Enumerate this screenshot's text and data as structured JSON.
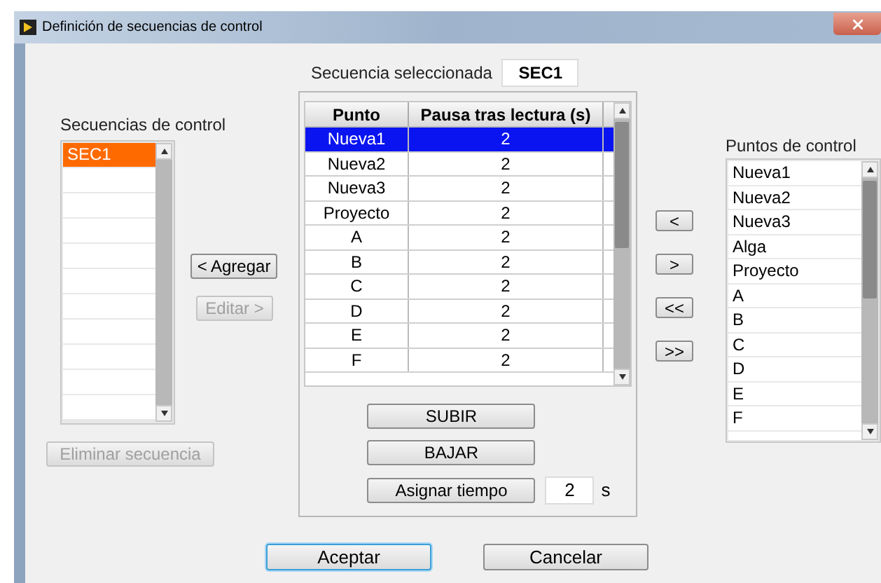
{
  "window": {
    "title": "Definición de secuencias de control"
  },
  "sequences": {
    "label": "Secuencias de control",
    "items": [
      {
        "label": "SEC1",
        "selected": true
      }
    ]
  },
  "sequence_buttons": [
    {
      "label": "< Agregar",
      "disabled": false
    },
    {
      "label": "Editar >",
      "disabled": true
    }
  ],
  "delete_button": {
    "label": "Eliminar secuencia",
    "disabled": true
  },
  "selected_sequence": {
    "label": "Secuencia seleccionada",
    "value": "SEC1"
  },
  "table": {
    "columns": [
      "Punto",
      "Pausa tras lectura (s)"
    ],
    "rows": [
      {
        "point": "Nueva1",
        "pause": "2",
        "selected": true
      },
      {
        "point": "Nueva2",
        "pause": "2",
        "selected": false
      },
      {
        "point": "Nueva3",
        "pause": "2",
        "selected": false
      },
      {
        "point": "Proyecto",
        "pause": "2",
        "selected": false
      },
      {
        "point": "A",
        "pause": "2",
        "selected": false
      },
      {
        "point": "B",
        "pause": "2",
        "selected": false
      },
      {
        "point": "C",
        "pause": "2",
        "selected": false
      },
      {
        "point": "D",
        "pause": "2",
        "selected": false
      },
      {
        "point": "E",
        "pause": "2",
        "selected": false
      },
      {
        "point": "F",
        "pause": "2",
        "selected": false
      }
    ]
  },
  "order_buttons": [
    "SUBIR",
    "BAJAR"
  ],
  "assign": {
    "button": "Asignar tiempo",
    "value": "2",
    "unit": "s"
  },
  "transfer_buttons": [
    "<",
    ">",
    "<<",
    ">>"
  ],
  "points": {
    "label": "Puntos de control",
    "items": [
      "Nueva1",
      "Nueva2",
      "Nueva3",
      "Alga",
      "Proyecto",
      "A",
      "B",
      "C",
      "D",
      "E",
      "F"
    ]
  },
  "dialog_buttons": [
    {
      "label": "Aceptar",
      "focused": true
    },
    {
      "label": "Cancelar",
      "focused": false
    }
  ]
}
